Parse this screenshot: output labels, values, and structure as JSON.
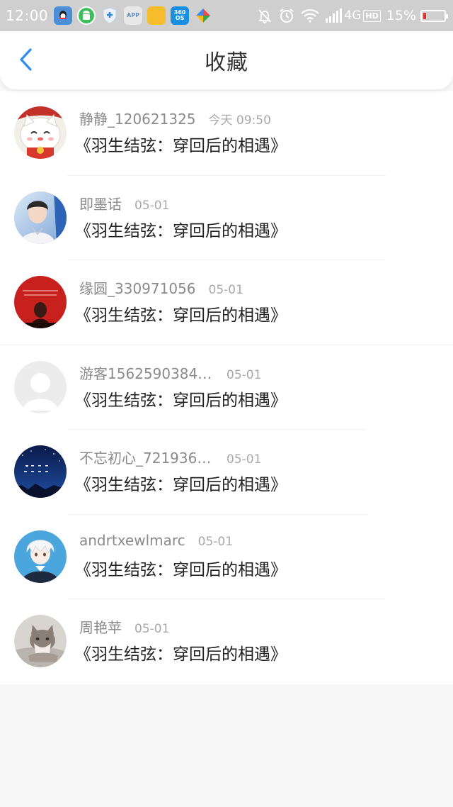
{
  "status_bar": {
    "time": "12:00",
    "network": "4G",
    "hd": "HD",
    "battery_percent": "15%",
    "battery_level": 0.15,
    "app_icons": [
      {
        "name": "qq-icon",
        "color": "#4a8fd8",
        "label": ""
      },
      {
        "name": "android-icon",
        "color": "#3cbf5a",
        "label": ""
      },
      {
        "name": "shield-plus-icon",
        "color": "#e9eef5",
        "label": ""
      },
      {
        "name": "app-icon",
        "color": "#e8e8e8",
        "label": "APP"
      },
      {
        "name": "folder-icon",
        "color": "#f5bd2b",
        "label": ""
      },
      {
        "name": "360os-icon",
        "color": "#1a8ee0",
        "label": "360 OS"
      },
      {
        "name": "puzzle-icon",
        "color": "#ea4c44",
        "label": ""
      }
    ],
    "right_icons": [
      "mute-bell-icon",
      "alarm-icon",
      "wifi-icon",
      "signal-icon"
    ]
  },
  "header": {
    "title": "收藏",
    "back_icon": "chevron-left-icon",
    "accent_color": "#2b8ee8"
  },
  "list": [
    {
      "name": "静静_120621325",
      "time": "今天 09:50",
      "title": "《羽生结弦：穿回后的相遇》",
      "avatar": "lucky-cat-avatar"
    },
    {
      "name": "即墨话",
      "time": "05-01",
      "title": "《羽生结弦：穿回后的相遇》",
      "avatar": "boy-photo-avatar"
    },
    {
      "name": "缘圆_330971056",
      "time": "05-01",
      "title": "《羽生结弦：穿回后的相遇》",
      "avatar": "red-girl-avatar"
    },
    {
      "name": "游客15625903842...",
      "time": "05-01",
      "title": "《羽生结弦：穿回后的相遇》",
      "avatar": "default-avatar"
    },
    {
      "name": "不忘初心_7219367...",
      "time": "05-01",
      "title": "《羽生结弦：穿回后的相遇》",
      "avatar": "night-sky-avatar"
    },
    {
      "name": "andrtxewlmarc",
      "time": "05-01",
      "title": "《羽生结弦：穿回后的相遇》",
      "avatar": "anime-boy-avatar"
    },
    {
      "name": "周艳苹",
      "time": "05-01",
      "title": "《羽生结弦：穿回后的相遇》",
      "avatar": "kitten-avatar"
    }
  ]
}
